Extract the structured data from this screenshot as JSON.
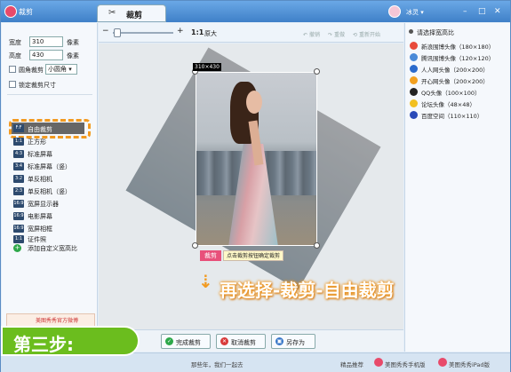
{
  "titlebar": {
    "app_title": "裁剪",
    "tab_label": "裁剪",
    "user": "冰灵 ▾",
    "btn_min": "–",
    "btn_max": "□",
    "btn_close": "✕"
  },
  "toolbar": {
    "zoom_out": "−",
    "zoom_in": "+",
    "ratio": "1:1",
    "original": "原大",
    "undo": "撤销",
    "redo": "重做",
    "reset": "重新开始"
  },
  "left": {
    "width_label": "宽度",
    "width_value": "310",
    "width_unit": "像素",
    "height_label": "高度",
    "height_value": "430",
    "height_unit": "像素",
    "round_crop_label": "圆角裁剪",
    "round_select": "小圆角 ▾",
    "lock_label": "锁定裁剪尺寸",
    "free_crop": {
      "icon": "F:F",
      "label": "自由裁剪"
    },
    "items": [
      {
        "icon": "1:1",
        "label": "正方形"
      },
      {
        "icon": "4:3",
        "label": "标准屏幕"
      },
      {
        "icon": "3:4",
        "label": "标准屏幕（竖）"
      },
      {
        "icon": "3:2",
        "label": "单反相机"
      },
      {
        "icon": "2:3",
        "label": "单反相机（竖）"
      },
      {
        "icon": "16:9",
        "label": "宽屏显示器"
      },
      {
        "icon": "16:9",
        "label": "电影屏幕"
      },
      {
        "icon": "16:9",
        "label": "宽屏相框"
      },
      {
        "icon": "1:1",
        "label": "证件照"
      }
    ],
    "add_label": "添加自定义宽高比",
    "weibo_label": "美图秀秀官方微博"
  },
  "right": {
    "title": "请选择宽高比",
    "items": [
      {
        "label": "新浪围博头像（180×180）",
        "color": "#e84a3a"
      },
      {
        "label": "腾讯围博头像（120×120）",
        "color": "#4a8ad8"
      },
      {
        "label": "人人网头像（200×200）",
        "color": "#2a6acc"
      },
      {
        "label": "开心网头像（200×200）",
        "color": "#f2a020"
      },
      {
        "label": "QQ头像（100×100）",
        "color": "#222222"
      },
      {
        "label": "论坛头像（48×48）",
        "color": "#f2c020"
      },
      {
        "label": "百度空间（110×110）",
        "color": "#2a4ab8"
      }
    ]
  },
  "canvas": {
    "size_badge": "310×430",
    "crop_button": "裁剪",
    "crop_hint": "点击裁剪按钮确定裁剪",
    "callout_arrow": "⇣",
    "callout": "再选择-裁剪-自由裁剪"
  },
  "bottom": {
    "done": "完成裁剪",
    "cancel": "取消裁剪",
    "save_as": "另存为"
  },
  "status": {
    "left": "那些年，我们一起去",
    "center": "精品推荐",
    "phone": "美图秀秀手机版",
    "ipad": "美图秀秀iPad版"
  },
  "step": {
    "label": "第三步:"
  },
  "colors": {
    "accent": "#f29a20",
    "step_green": "#6bbd1e",
    "crop_pink": "#e8507a"
  }
}
